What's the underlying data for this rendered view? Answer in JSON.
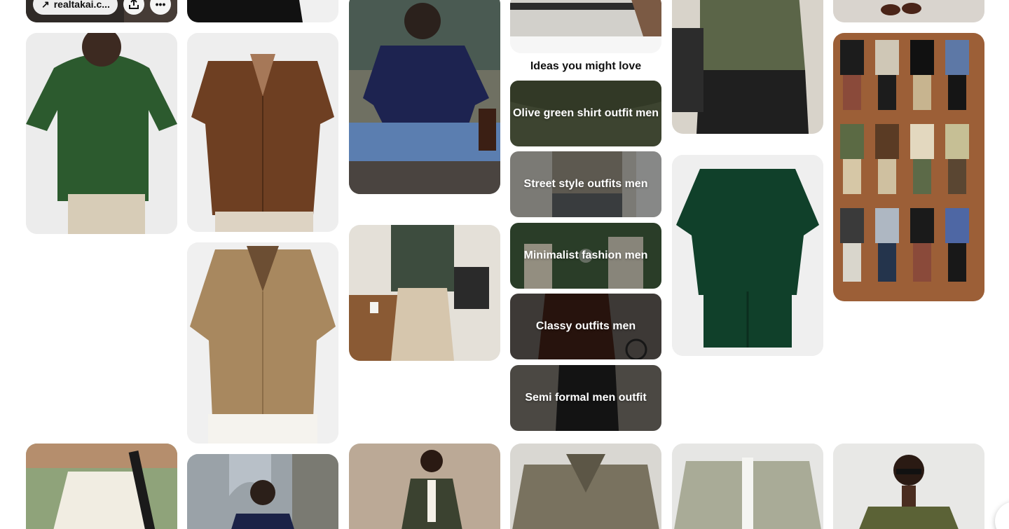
{
  "hovered_pin": {
    "source_label": "realtakai.c...",
    "link_icon": "arrow-up-right-icon",
    "share_icon": "share-upload-icon",
    "more_icon": "more-dots-icon"
  },
  "ideas": {
    "title": "Ideas you might love",
    "items": [
      {
        "label": "Olive green shirt outfit men"
      },
      {
        "label": "Street style outfits men"
      },
      {
        "label": "Minimalist fashion men"
      },
      {
        "label": "Classy outfits men"
      },
      {
        "label": "Semi formal men outfit"
      }
    ]
  },
  "colors": {
    "olive": "#5b6548",
    "forest": "#1f4d27",
    "brown": "#6e3f22",
    "tan": "#a8885f",
    "navy": "#1d2350",
    "outfit_bg": "#9c5f37"
  },
  "pins": [
    {
      "id": "green-henley-tee"
    },
    {
      "id": "brown-knit-shirt"
    },
    {
      "id": "tan-camp-collar-shirt"
    },
    {
      "id": "navy-tee-cafe"
    },
    {
      "id": "olive-shirt-coffee-bar"
    },
    {
      "id": "olive-polo"
    },
    {
      "id": "dark-green-shirt-shorts-set"
    },
    {
      "id": "outfit-grid-collage"
    },
    {
      "id": "white-shirt-outdoors"
    },
    {
      "id": "navy-shirt-arch"
    },
    {
      "id": "olive-overshirt-model"
    },
    {
      "id": "taupe-shirt"
    },
    {
      "id": "sage-overshirt"
    },
    {
      "id": "olive-polo-sunglasses"
    }
  ]
}
